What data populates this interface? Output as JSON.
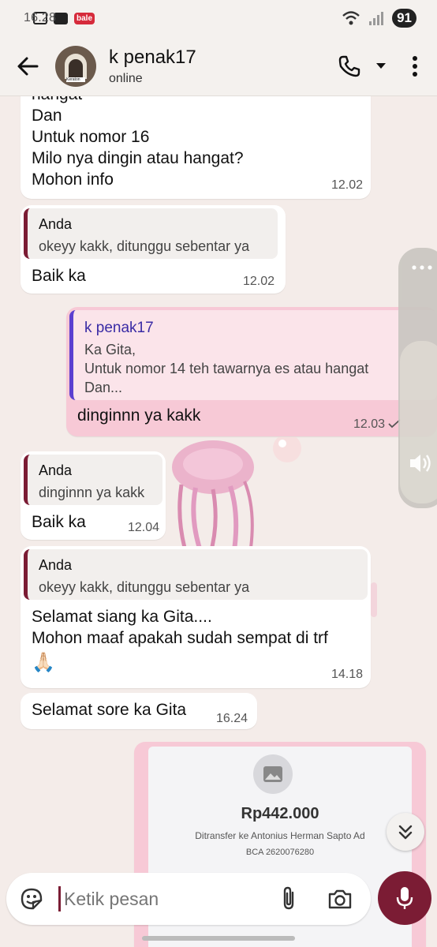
{
  "status_bar": {
    "time": "16.28",
    "app_badge": "bale",
    "battery": "91"
  },
  "header": {
    "contact_name": "k penak17",
    "contact_status": "online",
    "avatar_plate": "Keraton"
  },
  "messages": [
    {
      "lines": [
        "hangat",
        "Dan",
        "Untuk nomor 16",
        "Milo nya dingin atau hangat?",
        "Mohon info"
      ],
      "time": "12.02"
    },
    {
      "quote_name": "Anda",
      "quote_text": "okeyy kakk, ditunggu sebentar ya",
      "text": "Baik ka",
      "time": "12.02"
    },
    {
      "quote_name": "k penak17",
      "quote_lines": [
        "Ka Gita,",
        "Untuk nomor 14 teh tawarnya es atau hangat",
        "Dan..."
      ],
      "text": "dinginnn ya kakk",
      "time": "12.03"
    },
    {
      "quote_name": "Anda",
      "quote_text": "dinginnn ya kakk",
      "text": "Baik ka",
      "time": "12.04"
    },
    {
      "quote_name": "Anda",
      "quote_text": "okeyy kakk, ditunggu sebentar ya",
      "lines": [
        "Selamat siang ka Gita....",
        "Mohon maaf apakah sudah sempat di trf"
      ],
      "emoji": "🙏🏻",
      "time": "14.18"
    },
    {
      "text": "Selamat sore ka Gita",
      "time": "16.24"
    }
  ],
  "transfer_card": {
    "amount": "Rp442.000",
    "description": "Ditransfer ke Antonius Herman Sapto Ad",
    "account": "BCA 2620076280"
  },
  "composer": {
    "placeholder": "Ketik pesan"
  },
  "colors": {
    "accent": "#7b1c34",
    "outgoing_bubble": "#f7c9d6",
    "chat_background": "#f4ece9"
  },
  "icons": [
    "back-arrow-icon",
    "phone-icon",
    "chevron-down-icon",
    "more-vert-icon",
    "sticker-icon",
    "attach-icon",
    "camera-icon",
    "mic-icon",
    "chevron-double-down-icon",
    "image-icon",
    "read-check-icon"
  ]
}
